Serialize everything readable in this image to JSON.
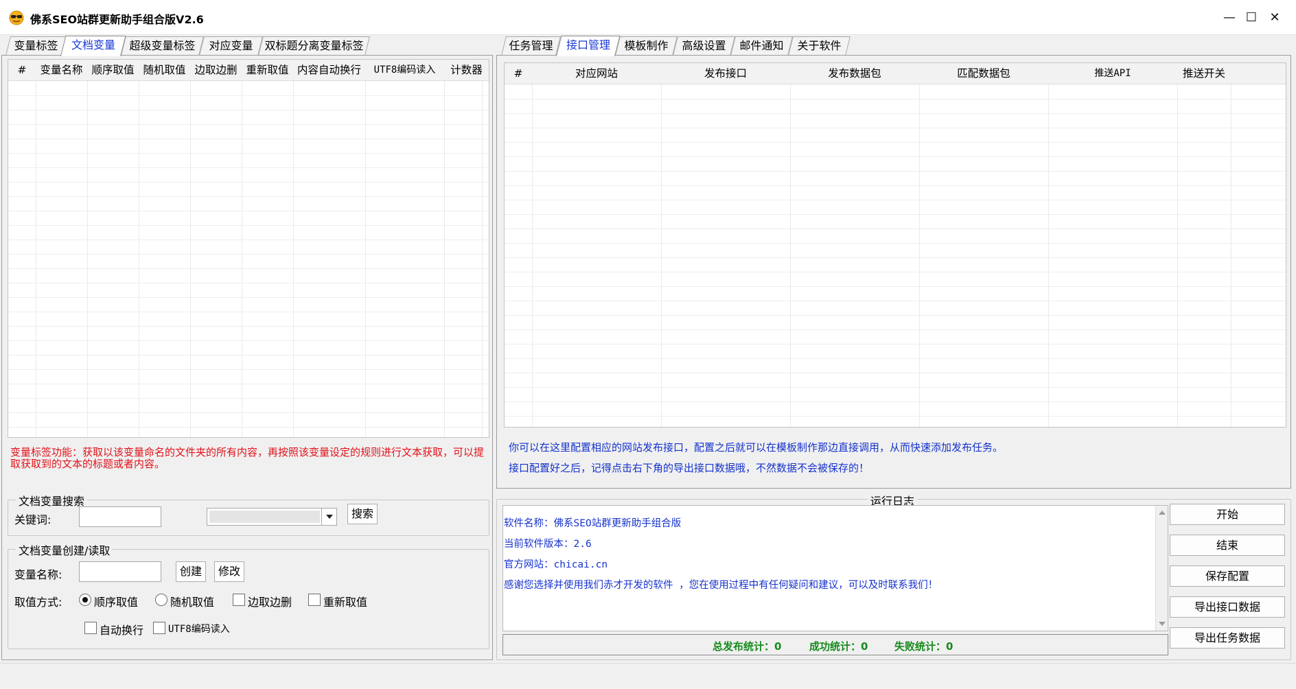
{
  "window": {
    "title": "佛系SEO站群更新助手组合版V2.6",
    "minimize": "—",
    "maximize": "☐",
    "close": "✕"
  },
  "left_tabs": [
    "变量标签",
    "文档变量",
    "超级变量标签",
    "对应变量",
    "双标题分离变量标签"
  ],
  "left_active_tab": 1,
  "left_grid": {
    "columns": [
      "#",
      "变量名称",
      "顺序取值",
      "随机取值",
      "边取边删",
      "重新取值",
      "内容自动换行",
      "UTF8编码读入",
      "计数器"
    ]
  },
  "left_description": "变量标签功能：获取以该变量命名的文件夹的所有内容，再按照该变量设定的规则进行文本获取，可以提取获取到的文本的标题或者内容。",
  "search_group": {
    "title": "文档变量搜索",
    "keyword_label": "关键词:",
    "keyword_value": "",
    "combo_value": "",
    "search_button": "搜索"
  },
  "create_group": {
    "title": "文档变量创建/读取",
    "name_label": "变量名称:",
    "name_value": "",
    "create_button": "创建",
    "modify_button": "修改",
    "mode_label": "取值方式:",
    "options": {
      "sequential": "顺序取值",
      "random": "随机取值",
      "take_delete": "边取边删",
      "retake": "重新取值",
      "auto_wrap": "自动换行",
      "utf8_read": "UTF8编码读入"
    }
  },
  "right_tabs": [
    "任务管理",
    "接口管理",
    "模板制作",
    "高级设置",
    "邮件通知",
    "关于软件"
  ],
  "right_active_tab": 1,
  "right_grid": {
    "columns": [
      "#",
      "对应网站",
      "发布接口",
      "发布数据包",
      "匹配数据包",
      "推送API",
      "推送开关"
    ]
  },
  "right_notes": [
    "你可以在这里配置相应的网站发布接口，配置之后就可以在模板制作那边直接调用，从而快速添加发布任务。",
    "接口配置好之后，记得点击右下角的导出接口数据哦，不然数据不会被保存的！"
  ],
  "log": {
    "title": "运行日志",
    "lines": [
      "软件名称：佛系SEO站群更新助手组合版",
      "当前软件版本：2.6",
      "官方网站：chicai.cn",
      "感谢您选择并使用我们赤才开发的软件 ，您在使用过程中有任何疑问和建议，可以及时联系我们！"
    ]
  },
  "actions": {
    "start": "开始",
    "stop": "结束",
    "save_config": "保存配置",
    "export_interface": "导出接口数据",
    "export_task": "导出任务数据"
  },
  "stats": {
    "total": "总发布统计：0",
    "success": "成功统计：0",
    "fail": "失败统计：0"
  }
}
